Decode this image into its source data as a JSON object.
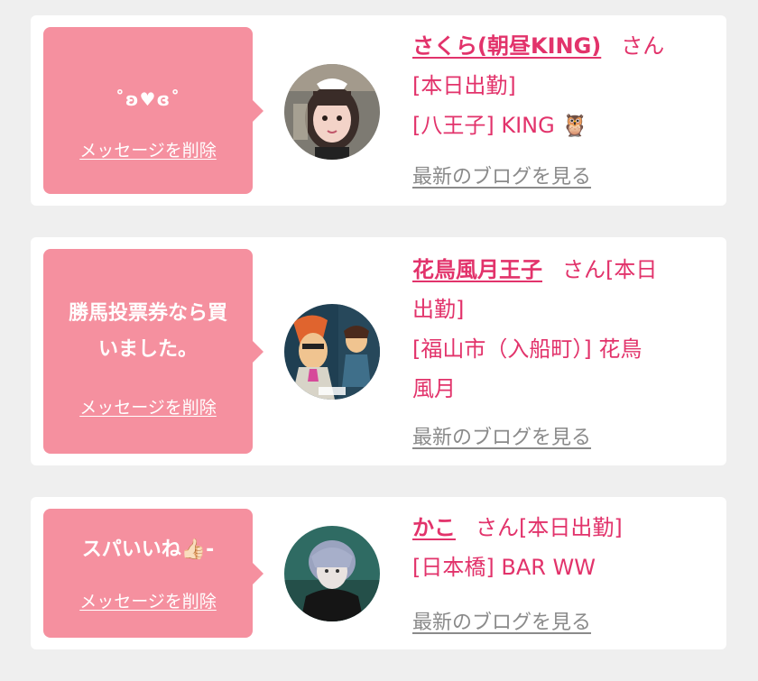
{
  "messages": [
    {
      "message": "˚ʚ♥ɞ˚",
      "delete_label": "メッセージを削除",
      "user_name": "さくら(朝昼KING)",
      "honorific": "さん",
      "status": "[本日出勤]",
      "location": "[八王子] KING 🦉",
      "blog_label": "最新のブログを見る",
      "avatar_icon": "girl-photo-avatar"
    },
    {
      "message": "勝馬投票券なら買いました。",
      "message_line1": "勝馬投票券なら買",
      "message_line2": "いました。",
      "delete_label": "メッセージを削除",
      "user_name": "花鳥風月王子",
      "honorific": "さん[本日",
      "status": "出勤]",
      "location": "[福山市（入船町）] 花鳥",
      "location_line2": "風月",
      "blog_label": "最新のブログを見る",
      "avatar_icon": "cartoon-avatar"
    },
    {
      "message": "スパいいね👍🏻-",
      "delete_label": "メッセージを削除",
      "user_name": "かこ",
      "honorific": "さん[本日出勤]",
      "location": "[日本橋] BAR WW",
      "blog_label": "最新のブログを見る",
      "avatar_icon": "person-photo-avatar"
    }
  ],
  "colors": {
    "bubble": "#f5909f",
    "accent": "#e2336b",
    "link_gray": "#8a8a8a",
    "background": "#efefef"
  }
}
